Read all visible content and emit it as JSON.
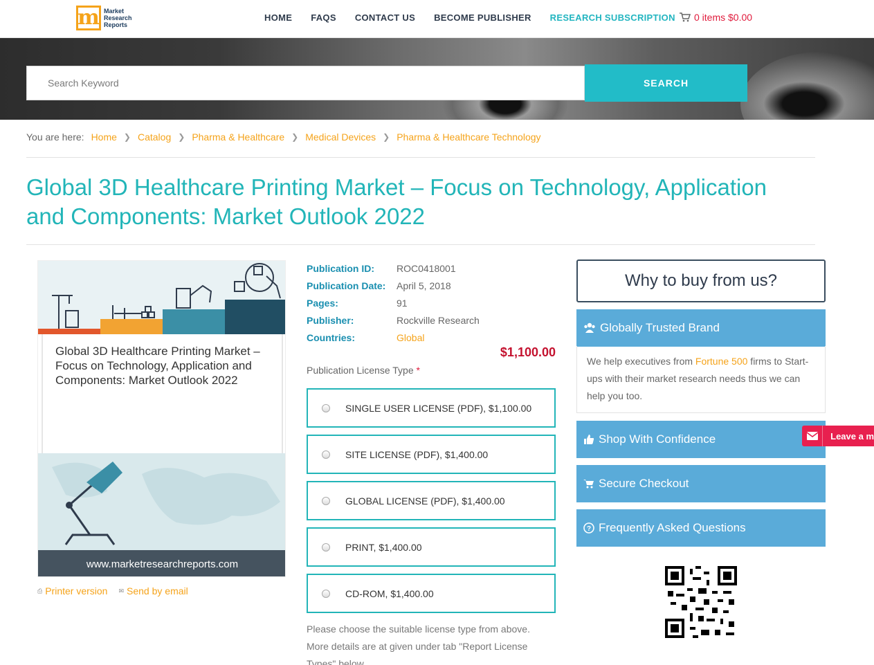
{
  "header": {
    "logo_text": [
      "Market",
      "Research",
      "Reports"
    ],
    "nav": [
      "HOME",
      "FAQS",
      "CONTACT US",
      "BECOME PUBLISHER",
      "RESEARCH SUBSCRIPTION"
    ],
    "cart": "0 items $0.00"
  },
  "search": {
    "placeholder": "Search Keyword",
    "button": "SEARCH"
  },
  "breadcrumb": {
    "label": "You are here:",
    "items": [
      "Home",
      "Catalog",
      "Pharma & Healthcare",
      "Medical Devices",
      "Pharma & Healthcare Technology"
    ]
  },
  "title": "Global 3D Healthcare Printing Market – Focus on Technology, Application and Components: Market Outlook 2022",
  "cover": {
    "title": "Global 3D Healthcare Printing Market – Focus on Technology, Application and Components: Market Outlook 2022",
    "url": "www.marketresearchreports.com"
  },
  "links": {
    "print": "Printer version",
    "email": "Send by email"
  },
  "details": {
    "rows": [
      {
        "k": "Publication ID:",
        "v": "ROC0418001"
      },
      {
        "k": "Publication Date:",
        "v": "April 5, 2018"
      },
      {
        "k": "Pages:",
        "v": "91"
      },
      {
        "k": "Publisher:",
        "v": "Rockville Research"
      },
      {
        "k": "Countries:",
        "v": "Global"
      }
    ],
    "price": "$1,100.00",
    "license_label": "Publication License Type",
    "required_mark": "*",
    "licenses": [
      "SINGLE USER LICENSE (PDF), $1,100.00",
      "SITE LICENSE (PDF), $1,400.00",
      "GLOBAL LICENSE (PDF), $1,400.00",
      "PRINT, $1,400.00",
      "CD-ROM, $1,400.00"
    ],
    "note": "Please choose the suitable license type from above. More details are at given under tab \"Report License Types\" below."
  },
  "sidebar": {
    "why": "Why to buy from us?",
    "trusted": "Globally Trusted Brand",
    "trusted_body_pre": "We help executives from ",
    "trusted_body_hl": "Fortune 500",
    "trusted_body_post": " firms to Start-ups with their market research needs thus we can help you too.",
    "shop": "Shop With Confidence",
    "checkout": "Secure Checkout",
    "faq": "Frequently Asked Questions"
  },
  "leave": "Leave a m",
  "colors": {
    "accent": "#22b5b8",
    "link": "#f5a31a",
    "price": "#c4122f",
    "sidebar": "#5aabd9"
  }
}
